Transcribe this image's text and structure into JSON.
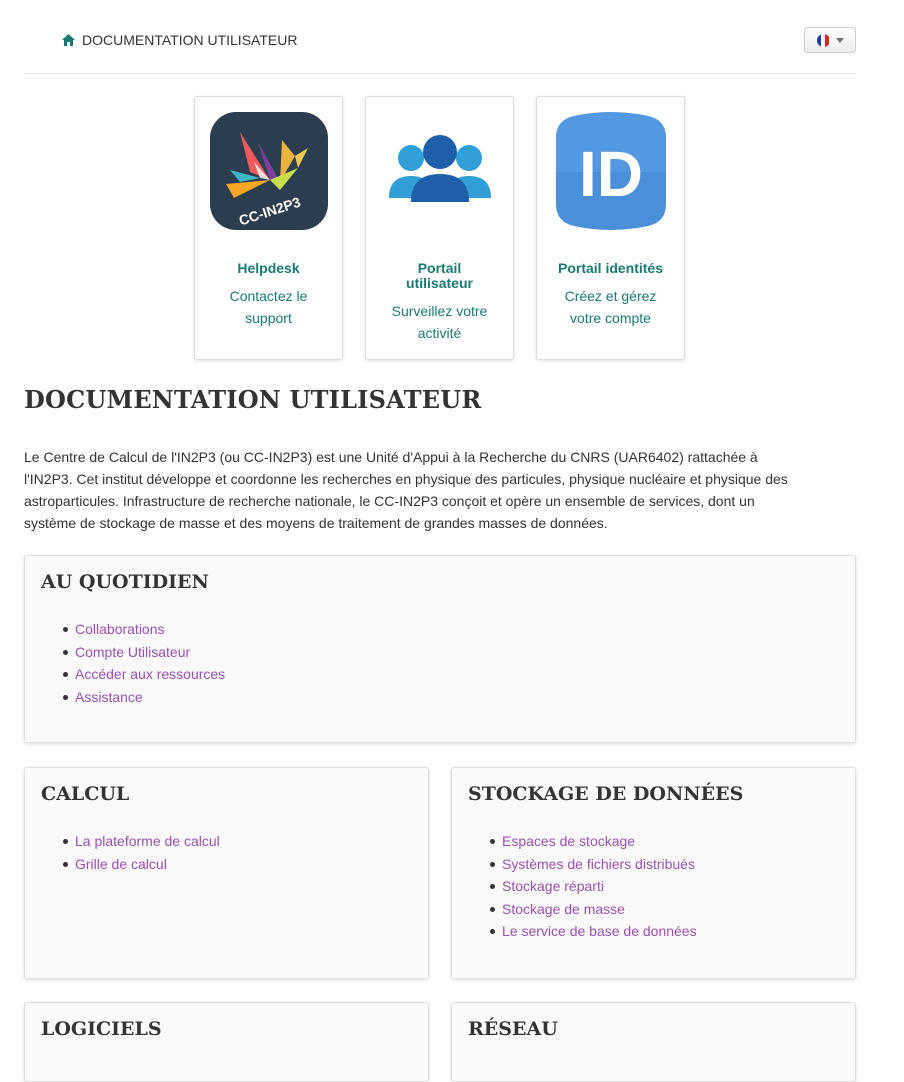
{
  "header": {
    "home_label": "DOCUMENTATION UTILISATEUR",
    "language": "Français"
  },
  "cards": [
    {
      "logo_text": "CC-IN2P3",
      "title": "Helpdesk",
      "description_lines": [
        "Contactez le",
        "support"
      ]
    },
    {
      "title_lines": [
        "Portail",
        "utilisateur"
      ],
      "description_lines": [
        "Surveillez votre",
        "activité"
      ]
    },
    {
      "logo_text": "ID",
      "title": "Portail identités",
      "description_lines": [
        "Créez et gérez",
        "votre compte"
      ]
    }
  ],
  "main": {
    "title": "DOCUMENTATION UTILISATEUR",
    "intro_lines": [
      "Le Centre de Calcul de l'IN2P3 (ou CC-IN2P3) est une Unité d'Appui à la Recherche du CNRS (UAR6402) rattachée à",
      "l'IN2P3. Cet institut développe et coordonne les recherches en physique des particules, physique nucléaire et physique des",
      "astroparticules. Infrastructure de recherche nationale, le CC-IN2P3 conçoit et opère un ensemble de services, dont un",
      "système de stockage de masse et des moyens de traitement de grandes masses de données."
    ]
  },
  "sections": {
    "quotidien": {
      "title": "AU QUOTIDIEN",
      "links": [
        "Collaborations",
        "Compte Utilisateur",
        "Accéder aux ressources",
        "Assistance"
      ]
    },
    "calcul": {
      "title": "CALCUL",
      "links": [
        "La plateforme de calcul",
        "Grille de calcul"
      ]
    },
    "stockage": {
      "title": "STOCKAGE DE DONNÉES",
      "links": [
        "Espaces de stockage",
        "Systèmes de fichiers distribués",
        "Stockage réparti",
        "Stockage de masse",
        "Le service de base de données"
      ]
    },
    "logiciels": {
      "title": "LOGICIELS"
    },
    "reseau": {
      "title": "RÉSEAU"
    }
  },
  "colors": {
    "link": "#9b4fb0",
    "card_text": "#1a7a73",
    "id_logo": "#4a90d9",
    "people_icon": "#2f9fd6"
  }
}
